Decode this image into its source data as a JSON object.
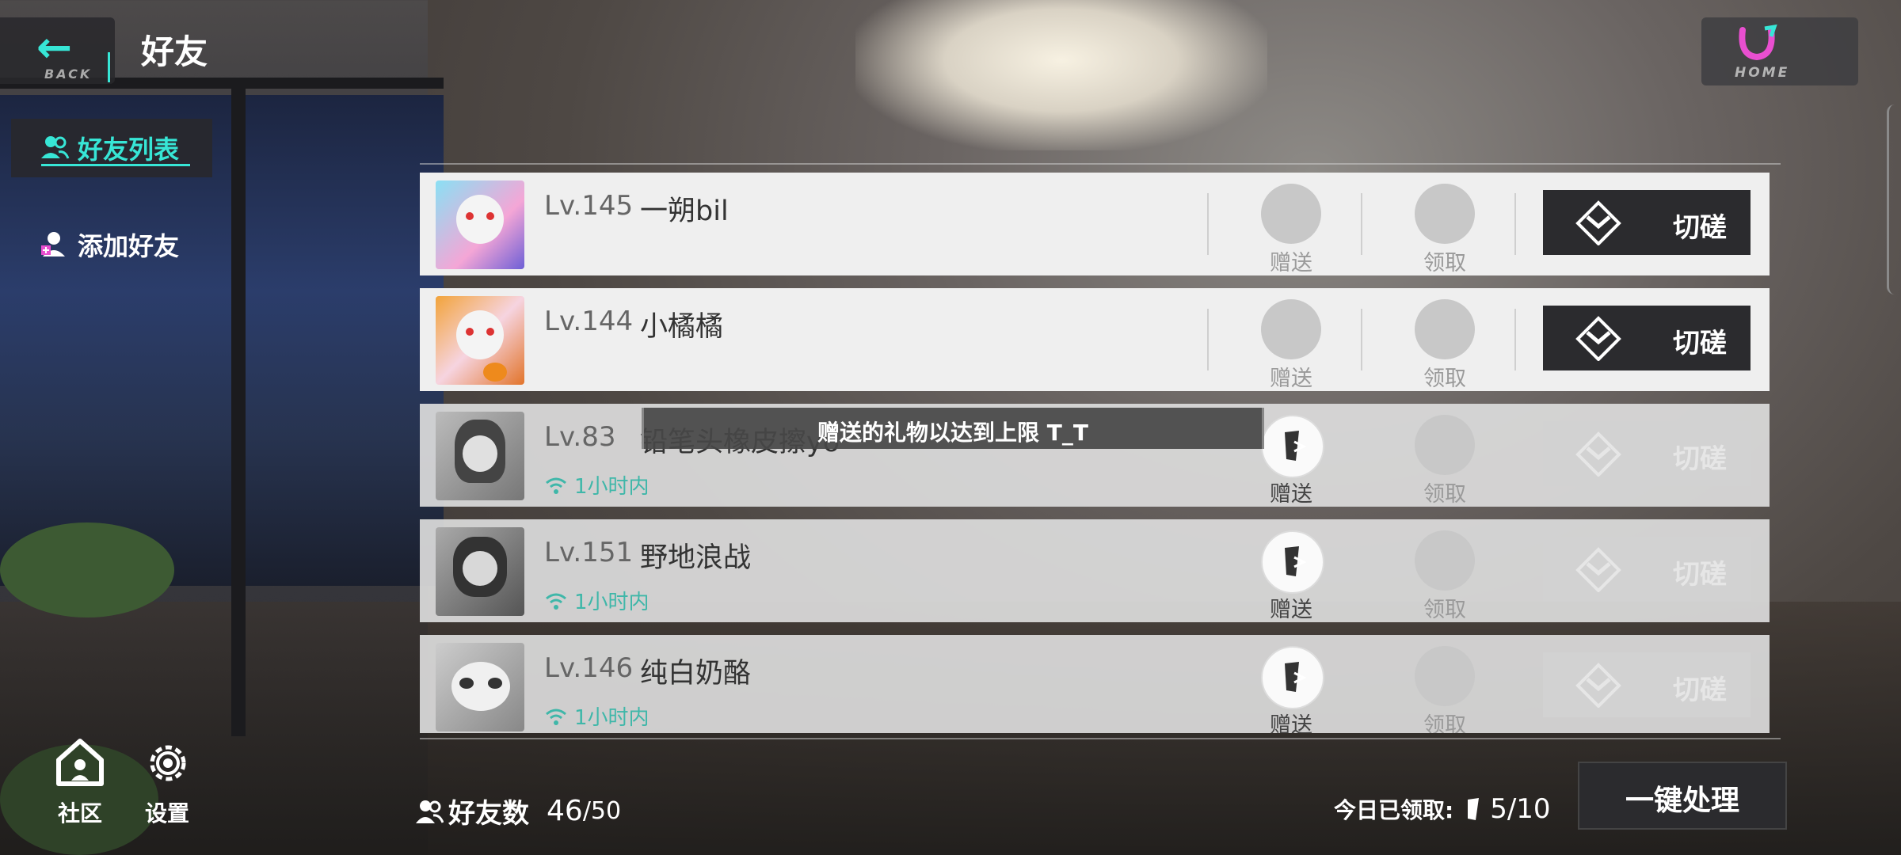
{
  "header": {
    "back_label": "BACK",
    "title": "好友",
    "home_label": "HOME"
  },
  "tabs": [
    {
      "label": "好友列表",
      "active": true,
      "icon": "friends-icon"
    },
    {
      "label": "添加好友",
      "active": false,
      "icon": "add-friend-icon"
    }
  ],
  "bottom_nav": [
    {
      "label": "社区",
      "icon": "community-house-icon"
    },
    {
      "label": "设置",
      "icon": "gear-icon"
    }
  ],
  "friends": [
    {
      "level": "Lv.145",
      "name": "一朔bil",
      "status": "",
      "gift_label": "赠送",
      "receive_label": "领取",
      "spar_label": "切磋",
      "online": true
    },
    {
      "level": "Lv.144",
      "name": "小橘橘",
      "status": "",
      "gift_label": "赠送",
      "receive_label": "领取",
      "spar_label": "切磋",
      "online": true
    },
    {
      "level": "Lv.83",
      "name": "铅笔头橡皮擦yo",
      "status": "1小时内",
      "gift_label": "赠送",
      "receive_label": "领取",
      "spar_label": "切磋",
      "online": false
    },
    {
      "level": "Lv.151",
      "name": "野地浪战",
      "status": "1小时内",
      "gift_label": "赠送",
      "receive_label": "领取",
      "spar_label": "切磋",
      "online": false
    },
    {
      "level": "Lv.146",
      "name": "纯白奶酪",
      "status": "1小时内",
      "gift_label": "赠送",
      "receive_label": "领取",
      "spar_label": "切磋",
      "online": false
    }
  ],
  "toast": {
    "message": "赠送的礼物以达到上限 T_T"
  },
  "footer": {
    "friend_count_label": "好友数",
    "friend_count_value": "46",
    "friend_count_max": "/50",
    "today_received_label": "今日已领取:",
    "today_received_value": "5/10",
    "one_click_label": "一键处理"
  },
  "colors": {
    "accent": "#37e6d6",
    "online_status": "#3fb7a9",
    "button_dark": "#2b2b2e"
  }
}
